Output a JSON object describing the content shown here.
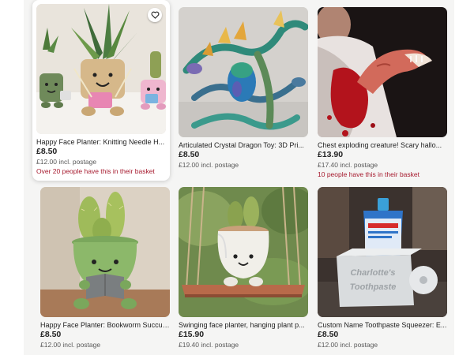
{
  "listings": [
    {
      "title": "Happy Face Planter: Knitting Needle H...",
      "price": "£8.50",
      "postage": "£12.00 incl. postage",
      "basket_note": "Over 20 people have this in their basket",
      "image": "planters-with-faces-holding-knitting",
      "favourite_icon": "heart-outline-icon"
    },
    {
      "title": "Articulated Crystal Dragon Toy: 3D Pri...",
      "price": "£8.50",
      "postage": "£12.00 incl. postage",
      "basket_note": "",
      "image": "colourful-crystal-dragons-with-egg"
    },
    {
      "title": "Chest exploding creature! Scary hallo...",
      "price": "£13.90",
      "postage": "£17.40 incl. postage",
      "basket_note": "10 people have this in their basket",
      "image": "bloody-chestburster-prop"
    },
    {
      "title": "Happy Face Planter: Bookworm Succul...",
      "price": "£8.50",
      "postage": "£12.00 incl. postage",
      "basket_note": "",
      "image": "green-planter-reading-book-with-cactus"
    },
    {
      "title": "Swinging face planter, hanging plant p...",
      "price": "£15.90",
      "postage": "£19.40 incl. postage",
      "basket_note": "",
      "image": "white-face-planter-on-wooden-swing"
    },
    {
      "title": "Custom Name Toothpaste Squeezer: E...",
      "price": "£8.50",
      "postage": "£12.00 incl. postage",
      "basket_note": "",
      "image": "toothpaste-squeezer-with-custom-name",
      "image_text": [
        "Charlotte's",
        "Toothpaste"
      ]
    }
  ],
  "colors": {
    "basket_note": "#a61a2e",
    "muted_text": "#595959",
    "background": "#f5f5f4"
  }
}
